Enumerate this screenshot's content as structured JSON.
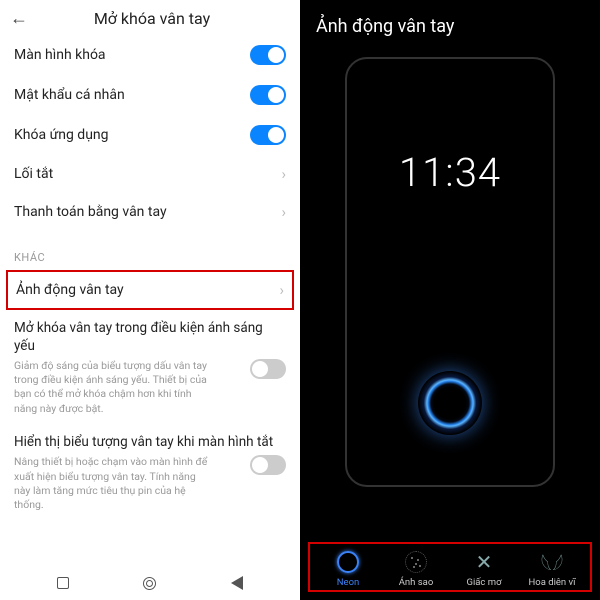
{
  "left": {
    "title": "Mở khóa vân tay",
    "rows": {
      "lockscreen": "Màn hình khóa",
      "password": "Mật khẩu cá nhân",
      "applock": "Khóa ứng dụng",
      "shortcut": "Lối tắt",
      "payment": "Thanh toán bằng vân tay"
    },
    "section": "KHÁC",
    "animation": "Ảnh động vân tay",
    "lowlight_title": "Mở khóa vân tay trong điều kiện ánh sáng yếu",
    "lowlight_sub": "Giảm độ sáng của biểu tượng dấu vân tay trong điều kiện ánh sáng yếu. Thiết bị của bạn có thể mở khóa chậm hơn khi tính năng này được bật.",
    "showicon_title": "Hiển thị biểu tượng vân tay khi màn hình tắt",
    "showicon_sub": "Nâng thiết bị hoặc chạm vào màn hình để xuất hiện biểu tượng vân tay. Tính năng này làm tăng mức tiêu thụ pin của hệ thống."
  },
  "right": {
    "title": "Ảnh động vân tay",
    "clock": "11:34",
    "styles": {
      "neon": "Neon",
      "star": "Ánh sao",
      "dream": "Giấc mơ",
      "butterfly": "Hoa diên vĩ"
    }
  }
}
